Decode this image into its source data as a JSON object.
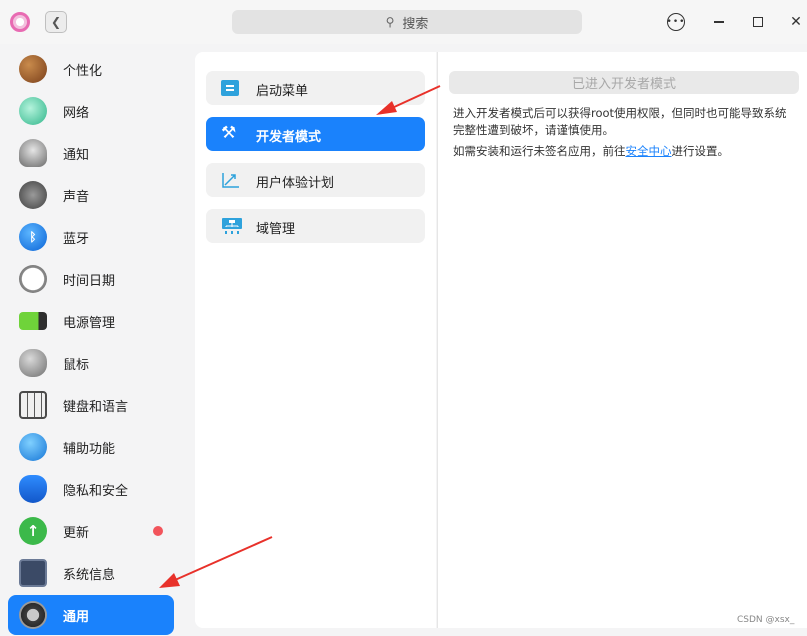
{
  "titlebar": {
    "search_placeholder": "搜索"
  },
  "sidebar": {
    "items": [
      {
        "label": "个性化",
        "icon": "palette-icon"
      },
      {
        "label": "网络",
        "icon": "network-icon"
      },
      {
        "label": "通知",
        "icon": "bell-icon"
      },
      {
        "label": "声音",
        "icon": "speaker-icon"
      },
      {
        "label": "蓝牙",
        "icon": "bluetooth-icon"
      },
      {
        "label": "时间日期",
        "icon": "clock-icon"
      },
      {
        "label": "电源管理",
        "icon": "battery-icon"
      },
      {
        "label": "鼠标",
        "icon": "mouse-icon"
      },
      {
        "label": "键盘和语言",
        "icon": "keyboard-icon"
      },
      {
        "label": "辅助功能",
        "icon": "accessibility-icon"
      },
      {
        "label": "隐私和安全",
        "icon": "shield-hand-icon"
      },
      {
        "label": "更新",
        "icon": "update-arrow-icon"
      },
      {
        "label": "系统信息",
        "icon": "system-info-icon"
      },
      {
        "label": "通用",
        "icon": "gear-icon",
        "active": true
      }
    ]
  },
  "middle": {
    "items": [
      {
        "label": "启动菜单",
        "icon": "boot-menu-icon"
      },
      {
        "label": "开发者模式",
        "icon": "tools-icon",
        "active": true
      },
      {
        "label": "用户体验计划",
        "icon": "trend-chart-icon"
      },
      {
        "label": "域管理",
        "icon": "domain-network-icon"
      }
    ]
  },
  "right": {
    "dev_mode_button": "已进入开发者模式",
    "description": "进入开发者模式后可以获得root使用权限，但同时也可能导致系统完整性遭到破坏，请谨慎使用。",
    "note_prefix": "如需安装和运行未签名应用，前往",
    "note_link": "安全中心",
    "note_suffix": "进行设置。"
  },
  "watermark": "CSDN @xsx_",
  "colors": {
    "accent": "#1a82fc",
    "badge": "#f2545b",
    "annotation_arrow": "#e8312a"
  }
}
